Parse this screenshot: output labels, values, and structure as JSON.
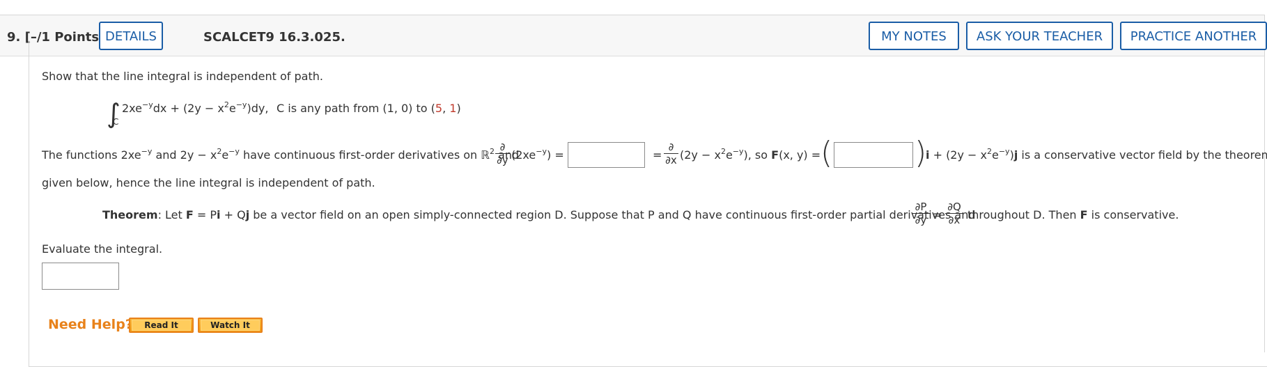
{
  "header": {
    "question_number": "9.  [–/1 Points]",
    "details_label": "DETAILS",
    "problem_code": "SCALCET9 16.3.025.",
    "my_notes_label": "MY NOTES",
    "ask_teacher_label": "ASK YOUR TEACHER",
    "practice_another_label": "PRACTICE ANOTHER"
  },
  "problem": {
    "prompt": "Show that the line integral is independent of path.",
    "integral_sub": "C",
    "integrand_part1": "2xe",
    "integrand_exp1": "−y",
    "integrand_part2": "dx + (2y − x",
    "integrand_exp2": "2",
    "integrand_part3": "e",
    "integrand_exp3": "−y",
    "integrand_part4": ")dy,",
    "path_text": "C is any path from (1, 0) to (",
    "path_point_x": "5",
    "path_sep": ", ",
    "path_point_y": "1",
    "path_end": ")"
  },
  "line2": {
    "t1": "The functions 2xe",
    "t1_exp": "−y",
    "t2": " and 2y − x",
    "t2_exp2": "2",
    "t2b": "e",
    "t2_exp": "−y",
    "t3": " have continuous first-order derivatives on ℝ",
    "t3_exp": "2",
    "t4": " and",
    "partial_sym": "∂",
    "dy": "∂y",
    "dx": "∂x",
    "t5": "(2xe",
    "t5_exp": "−y",
    "t5b": ") =",
    "t6": "=",
    "t7": "(2y − x",
    "t7_exp2": "2",
    "t7b": "e",
    "t7_exp": "−y",
    "t7c": "), so ",
    "t8_bold": "F",
    "t8": "(x, y) =",
    "t9_bold_i": "i",
    "t9": " + (2y − x",
    "t9_exp2": "2",
    "t9b": "e",
    "t9_exp": "−y",
    "t9c": ")",
    "t9_bold_j": "j",
    "t10": " is a conservative vector field by the theorem",
    "continuation": "given below, hence the line integral is independent of path."
  },
  "theorem": {
    "label": "Theorem",
    "text1": ": Let ",
    "F": "F",
    "text2": " = P",
    "i": "i",
    "text3": " + Q",
    "j": "j",
    "text4": " be a vector field on an open simply-connected region D. Suppose that P and Q have continuous first-order partial derivatives and",
    "frac1_num": "∂P",
    "frac1_den": "∂y",
    "eq": "=",
    "frac2_num": "∂Q",
    "frac2_den": "∂x",
    "text5": "throughout D. Then ",
    "F2": "F",
    "text6": " is conservative."
  },
  "evaluate": {
    "prompt": "Evaluate the integral."
  },
  "help": {
    "label": "Need Help?",
    "read_it": "Read It",
    "watch_it": "Watch It"
  },
  "colors": {
    "accent_blue": "#1a5da6",
    "help_orange": "#e8821b",
    "highlight_red": "#c0392b"
  }
}
